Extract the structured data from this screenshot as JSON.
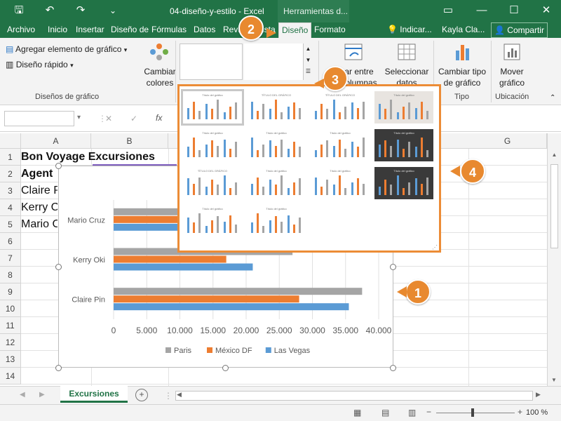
{
  "window": {
    "file_title": "04-diseño-y-estilo  -  Excel",
    "context_title": "Herramientas d...",
    "controls": [
      "▭",
      "—",
      "☐",
      "✕"
    ]
  },
  "qat": {
    "save": "🖫",
    "undo": "↶",
    "redo": "↷",
    "customize": "⌄"
  },
  "tabs": [
    "Archivo",
    "Inicio",
    "Insertar",
    "Diseño de",
    "Fórmulas",
    "Datos",
    "Revi",
    "ista",
    "Diseño",
    "Formato"
  ],
  "tabs_right": {
    "tell_me": "Indicar...",
    "user": "Kayla Cla...",
    "share": "Compartir"
  },
  "ribbon": {
    "add_element": "Agregar elemento de gráfico",
    "quick_layout": "Diseño rápido",
    "change_colors_1": "Cambiar",
    "change_colors_2": "colores",
    "group_layouts": "Diseños de gráfico",
    "switch_1": "ar entre",
    "switch_2": "columnas",
    "select_data_1": "Seleccionar",
    "select_data_2": "datos",
    "change_type_1": "Cambiar tipo",
    "change_type_2": "de gráfico",
    "group_type": "Tipo",
    "move_1": "Mover",
    "move_2": "gráfico",
    "group_location": "Ubicación"
  },
  "formula_bar": {
    "cancel": "✕",
    "confirm": "✓",
    "fx": "fx"
  },
  "columns": [
    "A",
    "B",
    "G"
  ],
  "rows": [
    "1",
    "2",
    "3",
    "4",
    "5",
    "6",
    "7",
    "8",
    "9",
    "10",
    "11",
    "12",
    "13",
    "14"
  ],
  "cells": {
    "A1": "Bon Voyage Excursiones",
    "A2": "Agent",
    "A3": "Claire P",
    "A4": "Kerry C",
    "A5": "Mario C"
  },
  "chart_data": {
    "type": "bar",
    "orientation": "horizontal",
    "categories": [
      "Mario Cruz",
      "Kerry Oki",
      "Claire Pin"
    ],
    "series": [
      {
        "name": "Paris",
        "color": "#a5a5a5",
        "values": [
          27000,
          27000,
          37500
        ]
      },
      {
        "name": "México DF",
        "color": "#ed7d31",
        "values": [
          10500,
          17000,
          28000
        ]
      },
      {
        "name": "Las Vegas",
        "color": "#5b9bd5",
        "values": [
          10500,
          21000,
          35500
        ]
      }
    ],
    "xlim": [
      0,
      40000
    ],
    "ticks": [
      "0",
      "5.000",
      "10.000",
      "15.000",
      "20.000",
      "25.000",
      "30.000",
      "35.000",
      "40.000"
    ],
    "legend": "bottom"
  },
  "gallery": {
    "styles": [
      {
        "title": "Título del gráfico",
        "bg": "#ffffff"
      },
      {
        "title": "TÍTULO DEL GRÁFICO",
        "bg": "#ffffff"
      },
      {
        "title": "TÍTULO DEL GRÁFICO",
        "bg": "#ffffff"
      },
      {
        "title": "Título del gráfico",
        "bg": "#e8e4e0"
      },
      {
        "title": "Título del gráfico",
        "bg": "#ffffff"
      },
      {
        "title": "Título del gráfico",
        "bg": "#ffffff"
      },
      {
        "title": "Título del gráfico",
        "bg": "#ffffff"
      },
      {
        "title": "Título del gráfico",
        "bg": "#3a3a3a"
      },
      {
        "title": "TÍTULO DEL GRÁFICO",
        "bg": "#ffffff"
      },
      {
        "title": "Título del gráfico",
        "bg": "#ffffff"
      },
      {
        "title": "Título del gráfico",
        "bg": "#ffffff"
      },
      {
        "title": "Título del gráfico",
        "bg": "#3a3a3a"
      },
      {
        "title": "Título del gráfico",
        "bg": "#ffffff"
      },
      {
        "title": "Título del gráfico",
        "bg": "#ffffff"
      }
    ]
  },
  "callouts": [
    "1",
    "2",
    "3",
    "4"
  ],
  "sheet_tab": "Excursiones",
  "status": {
    "zoom": "100 %",
    "minus": "−",
    "plus": "+"
  }
}
